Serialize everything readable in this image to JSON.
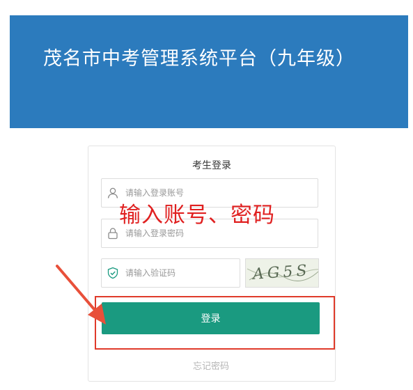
{
  "header": {
    "title": "茂名市中考管理系统平台（九年级）"
  },
  "login": {
    "title": "考生登录",
    "account_placeholder": "请输入登录账号",
    "password_placeholder": "请输入登录密码",
    "captcha_placeholder": "请输入验证码",
    "captcha_text": "AG5S",
    "login_label": "登录",
    "forgot_label": "忘记密码"
  },
  "annotation": {
    "text": "输入账号、密码"
  },
  "icons": {
    "account": "user-icon",
    "password": "lock-icon",
    "captcha": "shield-check-icon"
  },
  "colors": {
    "banner": "#2c7bbd",
    "button": "#1a9a80",
    "annotation": "#e02020"
  }
}
